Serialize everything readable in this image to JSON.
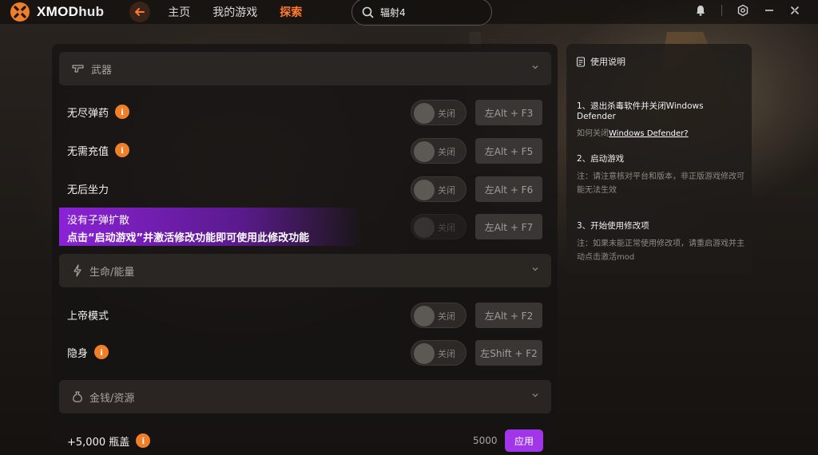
{
  "app": {
    "name_prefix": "XMOD",
    "name_suffix": "hub",
    "accent": "#ff7a2e",
    "purple": "#a136e8"
  },
  "nav": {
    "items": [
      "主页",
      "我的游戏",
      "探索"
    ],
    "active_index": 2
  },
  "search": {
    "value": "辐射4"
  },
  "sections": {
    "weapons": {
      "title": "武器",
      "icon": "pistol-icon"
    },
    "health": {
      "title": "生命/能量",
      "icon": "lightning-icon"
    },
    "money": {
      "title": "金钱/资源",
      "icon": "money-bag-icon"
    }
  },
  "rows": [
    {
      "label": "无尽弹药",
      "info": true,
      "toggle": "关闭",
      "hotkey": "左Alt + F3"
    },
    {
      "label": "无需充值",
      "info": true,
      "toggle": "关闭",
      "hotkey": "左Alt + F5"
    },
    {
      "label": "无后坐力",
      "info": false,
      "toggle": "关闭",
      "hotkey": "左Alt + F6"
    },
    {
      "label": "没有子弹扩散",
      "info": false,
      "toggle": "关闭",
      "hotkey": "左Alt + F7"
    },
    {
      "label": "上帝模式",
      "info": false,
      "toggle": "关闭",
      "hotkey": "左Alt + F2"
    },
    {
      "label": "隐身",
      "info": true,
      "toggle": "关闭",
      "hotkey": "左Shift + F2"
    }
  ],
  "promo": {
    "line1": "没有子弹扩散",
    "line2": "点击“启动游戏”并激活修改功能即可使用此修改功能"
  },
  "money_row": {
    "label": "+5,000 瓶盖",
    "value": "5000",
    "apply": "应用"
  },
  "instructions": {
    "title": "使用说明",
    "step1_title": "1、退出杀毒软件并关闭Windows Defender",
    "step1_desc_prefix": "如何关闭",
    "step1_link": "Windows Defender?",
    "step2_title": "2、启动游戏",
    "step2_desc": "注：请注意核对平台和版本，非正版游戏修改可能无法生效",
    "step3_title": "3、开始使用修改项",
    "step3_desc": "注：如果未能正常使用修改项，请重启游戏并主动点击激活mod"
  }
}
